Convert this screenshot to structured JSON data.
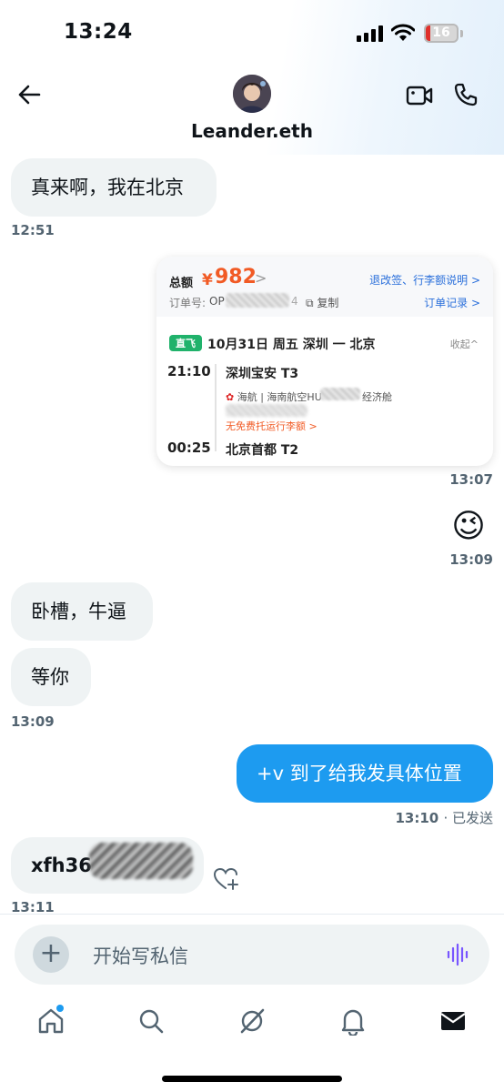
{
  "status_bar": {
    "time": "13:24",
    "battery": "16",
    "battery_level": 0.16
  },
  "header": {
    "name": "Leander.eth"
  },
  "messages": [
    {
      "text": "真来啊，我在北京",
      "time": "12:51"
    },
    {
      "card_time": "13:07"
    },
    {
      "emoji": "😉",
      "time": "13:09"
    },
    {
      "text": "卧槽，牛逼"
    },
    {
      "text": "等你",
      "time": "13:09"
    },
    {
      "text": "+v 到了给我发具体位置",
      "time": "13:10",
      "status": "· 已发送"
    },
    {
      "text": "xfh36",
      "time": "13:11"
    }
  ],
  "booking_card": {
    "total_label": "总额",
    "currency": "¥",
    "price": "982",
    "price_arrow": ">",
    "policy_link": "退改签、行李额说明 >",
    "order_label": "订单号:",
    "order_prefix": "OP",
    "order_suffix": "4",
    "copy_label": "复制",
    "order_record": "订单记录 >",
    "direct_badge": "直飞",
    "date_route": "10月31日 周五   深圳 一 北京",
    "collapse": "收起^",
    "departure_time": "21:10",
    "departure_airport": "深圳宝安 T3",
    "airline": "海航 | 海南航空HU",
    "cabin": "经济舱",
    "baggage": "无免费托运行李额 >",
    "arrival_time": "00:25",
    "arrival_airport": "北京首都 T2"
  },
  "compose": {
    "placeholder": "开始写私信"
  },
  "icons": {
    "back": "arrow-left-icon",
    "video": "video-camera-icon",
    "phone": "phone-icon",
    "reaction": "heart-plus-icon",
    "add": "plus-icon",
    "voice": "voice-wave-icon",
    "tabs": [
      "home-icon",
      "search-icon",
      "grok-icon",
      "bell-icon",
      "mail-icon"
    ]
  },
  "colors": {
    "accent": "#1d9bf0",
    "price": "#f15a24",
    "voice": "#7856ff"
  }
}
